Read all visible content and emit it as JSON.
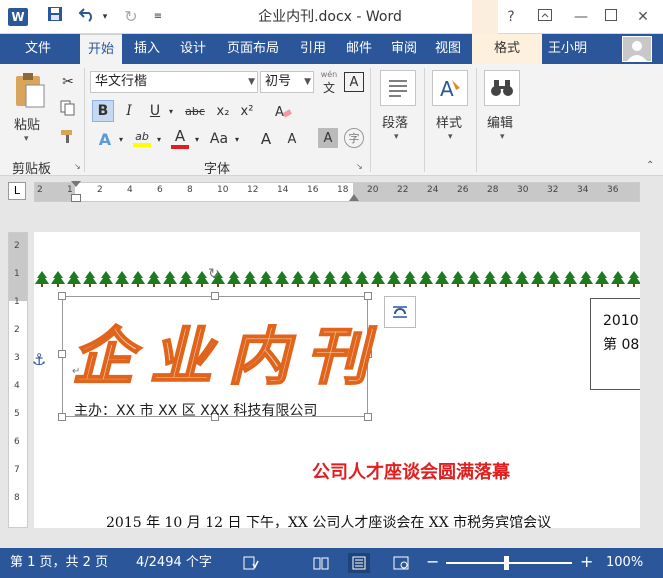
{
  "window": {
    "title": "企业内刊.docx - Word",
    "help": "?",
    "app_icon": "W"
  },
  "tabs": [
    {
      "label": "文件"
    },
    {
      "label": "开始"
    },
    {
      "label": "插入"
    },
    {
      "label": "设计"
    },
    {
      "label": "页面布局"
    },
    {
      "label": "引用"
    },
    {
      "label": "邮件"
    },
    {
      "label": "审阅"
    },
    {
      "label": "视图"
    },
    {
      "label": "格式"
    }
  ],
  "user": {
    "name": "王小明"
  },
  "ribbon": {
    "clipboard": {
      "paste_label": "粘贴",
      "group_label": "剪贴板"
    },
    "font": {
      "font_name": "华文行楷",
      "font_size": "初号",
      "phonetic_top": "wén",
      "phonetic_bottom": "文",
      "char_border": "A",
      "bold": "B",
      "italic": "I",
      "underline": "U",
      "strike": "abc",
      "subscript": "x₂",
      "superscript": "x²",
      "text_effect": "A",
      "highlight": "ab",
      "font_color": "A",
      "change_case": "Aa",
      "grow": "A",
      "shrink": "A",
      "shading": "A",
      "enclose": "字",
      "group_label": "字体"
    },
    "paragraph": {
      "label": "段落"
    },
    "styles": {
      "label": "样式"
    },
    "editing": {
      "label": "编辑"
    }
  },
  "ruler": {
    "h_ticks": [
      "2",
      "1",
      "2",
      "4",
      "6",
      "8",
      "10",
      "12",
      "14",
      "16",
      "18",
      "20",
      "22",
      "24",
      "26",
      "28",
      "30",
      "32",
      "34",
      "36"
    ],
    "v_ticks": [
      "2",
      "1",
      "1",
      "2",
      "3",
      "4",
      "5",
      "6",
      "7",
      "8"
    ]
  },
  "document": {
    "wordart": "企业内刊",
    "sponsor": "主办：XX 市 XX 区 XXX 科技有限公司",
    "date_line1": "2010",
    "date_line2": "第 08",
    "headline": "公司人才座谈会圆满落幕",
    "body": "2015 年 10 月 12 日 下午，XX 公司人才座谈会在 XX 市税务宾馆会议"
  },
  "status": {
    "page": "第 1 页，共 2 页",
    "words": "4/2494 个字",
    "zoom": "100%"
  },
  "colors": {
    "brand": "#2b579a",
    "wordart_fill": "#f4c79e",
    "wordart_stroke": "#e0641c",
    "headline": "#e02020",
    "trees": "#1e7a1e"
  }
}
